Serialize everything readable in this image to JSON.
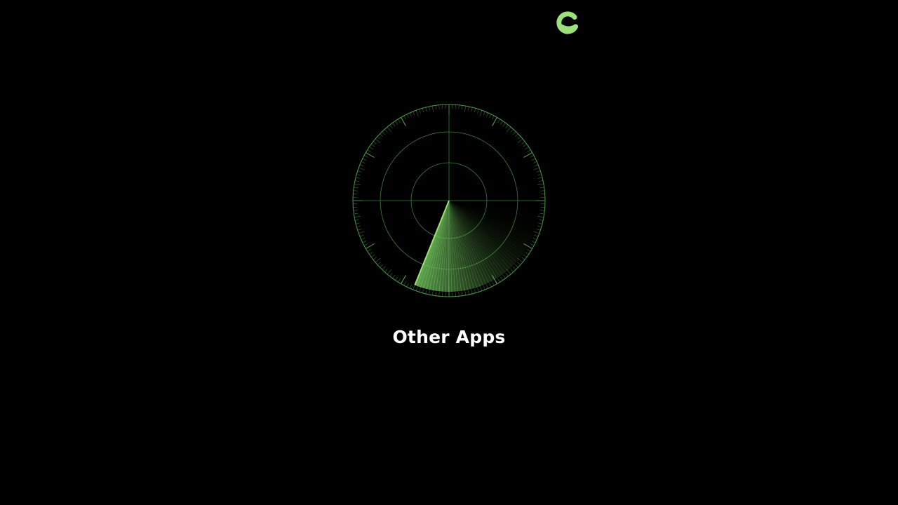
{
  "screen": {
    "label": "Other Apps"
  },
  "icons": {
    "logo": "app-logo-icon",
    "radar": "radar-scan-icon"
  },
  "colors": {
    "background": "#000000",
    "accent": "#9be07a",
    "radar_line": "#4f9a4a",
    "text": "#ffffff"
  }
}
